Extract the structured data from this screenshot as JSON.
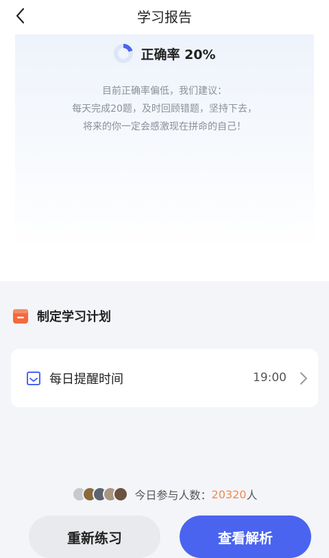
{
  "header": {
    "title": "学习报告"
  },
  "report": {
    "accuracy_label": "正确率 20%",
    "accuracy_percent": 20,
    "advice_lines": [
      "目前正确率偏低，我们建议：",
      "每天完成20题，及时回顾错题，坚持下去，",
      "将来的你一定会感激现在拼命的自己！"
    ]
  },
  "plan": {
    "title": "制定学习计划",
    "reminder_label": "每日提醒时间",
    "reminder_time": "19:00"
  },
  "participants": {
    "prefix": "今日参与人数：",
    "count": "20320",
    "suffix": "人"
  },
  "buttons": {
    "retry": "重新练习",
    "analysis": "查看解析"
  },
  "colors": {
    "accent": "#4a64f0",
    "ring_track": "#dde6f8",
    "plan_icon": "#f26a3d",
    "count": "#ef8a55"
  }
}
